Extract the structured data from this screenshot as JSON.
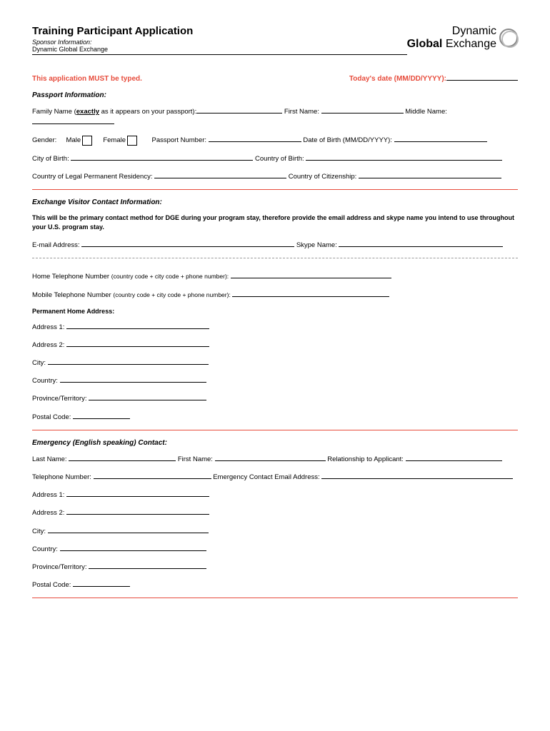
{
  "header": {
    "title": "Training Participant Application",
    "sponsor_label": "Sponsor Information:",
    "sponsor_name": "Dynamic Global Exchange",
    "logo_top": "Dynamic",
    "logo_global": "Global",
    "logo_exchange": "Exchange"
  },
  "notice": {
    "typed": "This application MUST be typed.",
    "date_label": "Today's date (MM/DD/YYYY):"
  },
  "passport": {
    "section": "Passport Information:",
    "family_name": "Family Name (",
    "exactly": "exactly",
    "family_name_suffix": " as it appears on your passport):",
    "first_name": "First Name:",
    "middle_name": "Middle Name:",
    "gender": "Gender:",
    "male": "Male",
    "female": "Female",
    "passport_number": "Passport Number:",
    "dob": "Date of Birth (MM/DD/YYYY):",
    "city_birth": "City of Birth:",
    "country_birth": "Country of Birth:",
    "residency": "Country of Legal Permanent Residency:",
    "citizenship": "Country of Citizenship:"
  },
  "contact": {
    "section": "Exchange Visitor Contact Information:",
    "note": "This will be the primary contact method for DGE during your program stay, therefore provide the email address and skype name you intend to use throughout your U.S. program stay.",
    "email": "E-mail Address:",
    "skype": "Skype Name:",
    "home_tel": "Home Telephone Number",
    "tel_note": "(country code + city code + phone number):",
    "mobile_tel": "Mobile Telephone Number",
    "perm_addr": "Permanent Home Address:",
    "address1": "Address 1:",
    "address2": "Address 2:",
    "city": "City:",
    "country": "Country:",
    "province": "Province/Territory:",
    "postal": "Postal Code:"
  },
  "emergency": {
    "section": "Emergency (English speaking) Contact:",
    "last_name": "Last Name:",
    "first_name": "First Name:",
    "relationship": "Relationship to Applicant:",
    "telephone": "Telephone Number:",
    "email": "Emergency Contact Email Address:",
    "address1": "Address 1:",
    "address2": "Address 2:",
    "city": "City:",
    "country": "Country:",
    "province": "Province/Territory:",
    "postal": "Postal Code:"
  }
}
